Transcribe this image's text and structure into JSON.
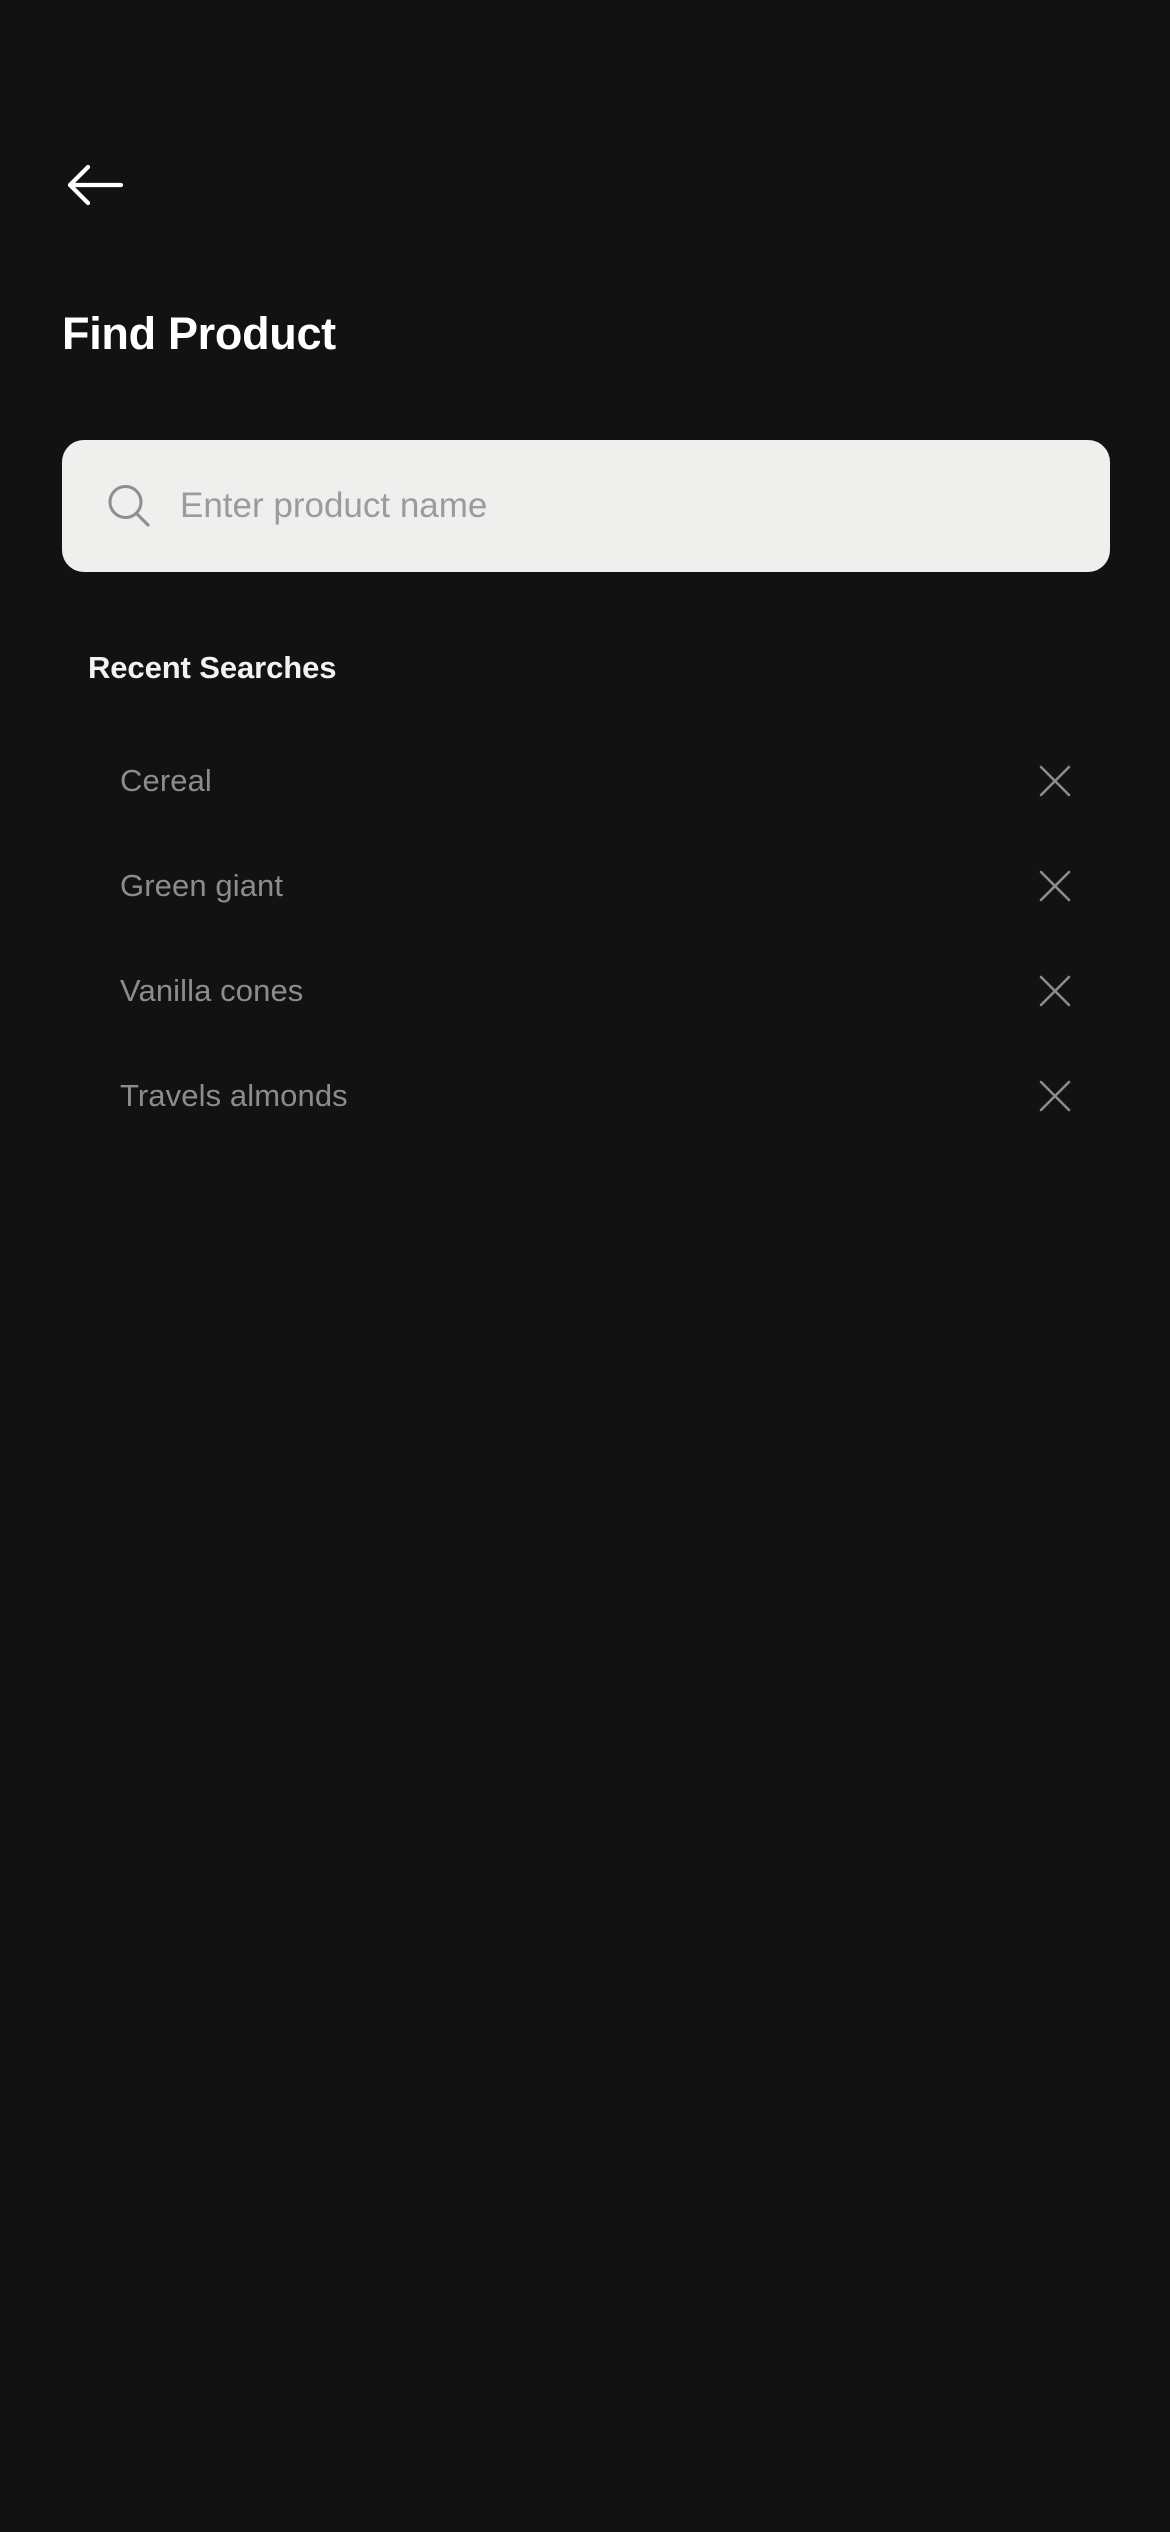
{
  "theme": {
    "background": "#121212",
    "title_color": "#ffffff",
    "search_field_background": "#EFEFEE",
    "placeholder_color": "#9b9b9b",
    "list_item_color": "#8c8c8c",
    "icon_color": "#8c8c8c"
  },
  "header": {
    "back_icon": "arrow-left-icon",
    "title": "Find Product"
  },
  "search": {
    "icon": "search-icon",
    "placeholder": "Enter product name",
    "value": ""
  },
  "recent": {
    "heading": "Recent Searches",
    "remove_icon": "close-icon",
    "items": [
      {
        "label": "Cereal"
      },
      {
        "label": "Green giant"
      },
      {
        "label": "Vanilla cones"
      },
      {
        "label": "Travels almonds"
      }
    ]
  }
}
